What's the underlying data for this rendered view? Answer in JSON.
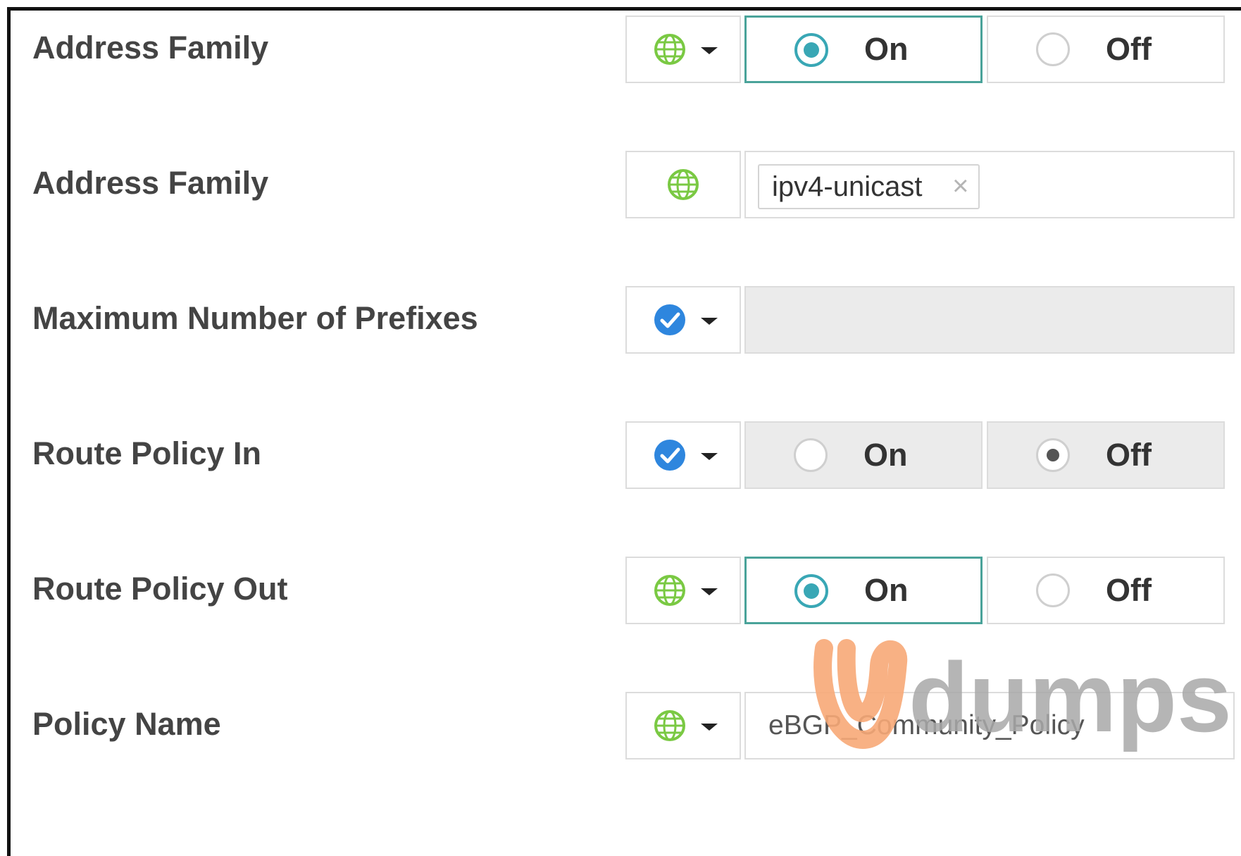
{
  "colors": {
    "selected_border": "#4aa39a",
    "radio_fill": "#39a7b5",
    "globe": "#7ac943",
    "check": "#2e86de",
    "disabled_bg": "#ebebeb",
    "watermark_orange": "#f7a877",
    "watermark_gray": "#a9a9a9"
  },
  "rows": [
    {
      "label": "Address Family",
      "scope_icon": "globe-icon",
      "on_label": "On",
      "off_label": "Off",
      "selected": "On"
    },
    {
      "label": "Address Family",
      "scope_icon": "globe-icon",
      "tag_value": "ipv4-unicast",
      "tag_remove": "×"
    },
    {
      "label": "Maximum Number of Prefixes",
      "scope_icon": "check-icon",
      "value": ""
    },
    {
      "label": "Route Policy In",
      "scope_icon": "check-icon",
      "on_label": "On",
      "off_label": "Off",
      "selected": "Off",
      "disabled": true
    },
    {
      "label": "Route Policy Out",
      "scope_icon": "globe-icon",
      "on_label": "On",
      "off_label": "Off",
      "selected": "On"
    },
    {
      "label": "Policy Name",
      "scope_icon": "globe-icon",
      "value": "eBGP_Community_Policy"
    }
  ],
  "watermark": {
    "text": "dumps"
  }
}
